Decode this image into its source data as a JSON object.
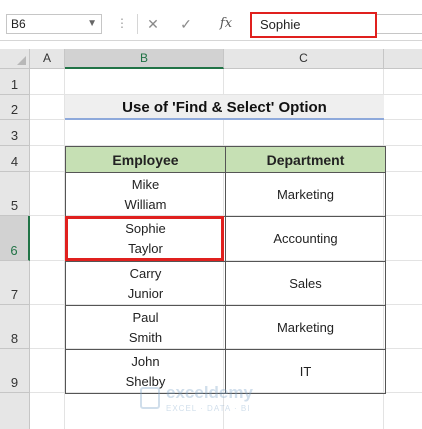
{
  "formula_bar": {
    "name_box": "B6",
    "cancel_symbol": "✕",
    "enter_symbol": "✓",
    "function_symbol": "fx",
    "formula_value": "Sophie"
  },
  "columns": [
    "A",
    "B",
    "C"
  ],
  "selected_column": "B",
  "rows": [
    "1",
    "2",
    "3",
    "4",
    "5",
    "6",
    "7",
    "8",
    "9"
  ],
  "selected_row": "6",
  "sheet": {
    "title": "Use of 'Find & Select' Option",
    "headers": [
      "Employee",
      "Department"
    ],
    "records": [
      {
        "employee_first": "Mike",
        "employee_last": "William",
        "department": "Marketing"
      },
      {
        "employee_first": "Sophie",
        "employee_last": "Taylor",
        "department": "Accounting"
      },
      {
        "employee_first": "Carry",
        "employee_last": "Junior",
        "department": "Sales"
      },
      {
        "employee_first": "Paul",
        "employee_last": "Smith",
        "department": "Marketing"
      },
      {
        "employee_first": "John",
        "employee_last": "Shelby",
        "department": "IT"
      }
    ]
  },
  "watermark": {
    "name": "exceldemy",
    "tagline": "EXCEL · DATA · BI"
  },
  "colors": {
    "header_fill": "#c6e0b4",
    "highlight_border": "#e0201e",
    "title_underline": "#8ea9db"
  }
}
